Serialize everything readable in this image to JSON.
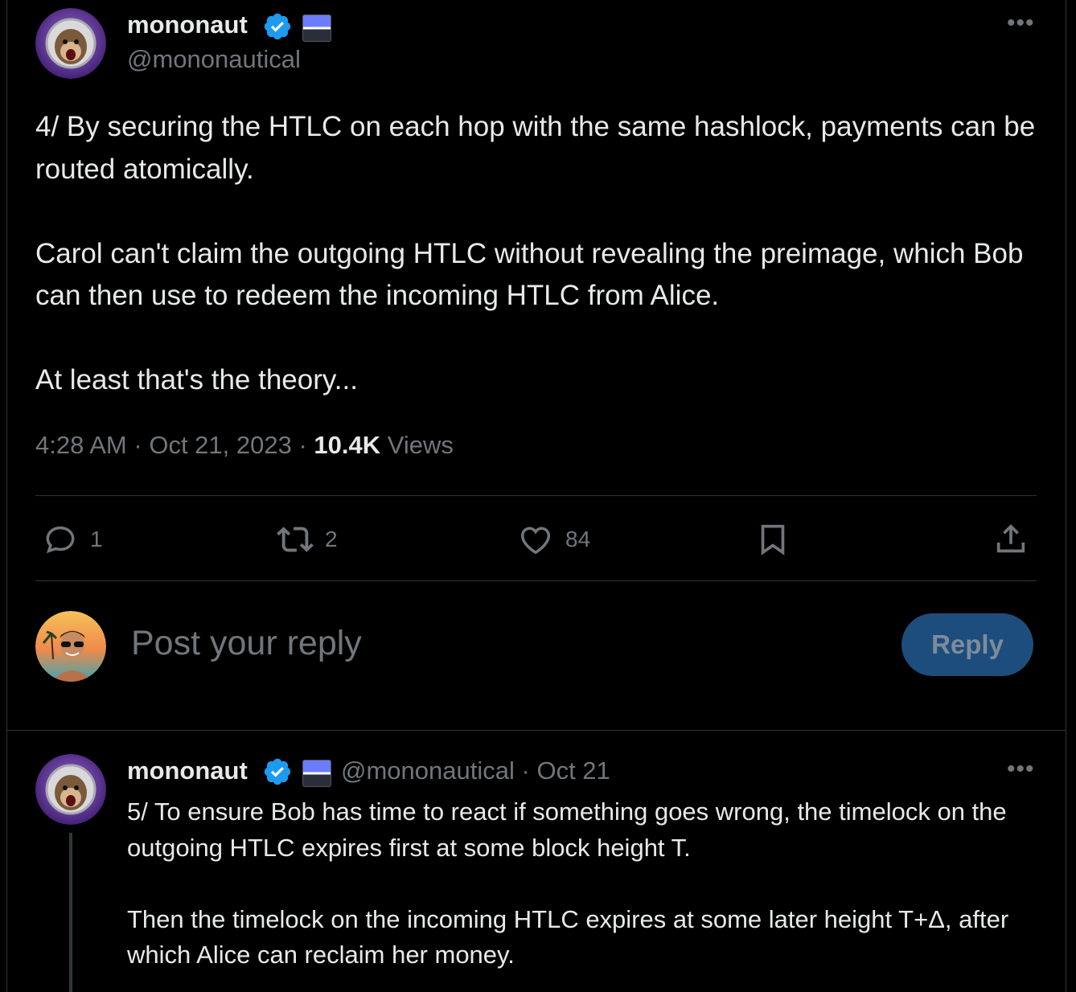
{
  "main_post": {
    "author_name": "mononaut",
    "author_handle": "@mononautical",
    "paragraphs": [
      "4/ By securing the HTLC on each hop with the same hashlock, payments can be routed atomically.",
      "Carol can't claim the outgoing HTLC without revealing the preimage, which Bob can then use to redeem the incoming HTLC from Alice.",
      "At least that's the theory..."
    ],
    "time": "4:28 AM",
    "date": "Oct 21, 2023",
    "views_count": "10.4K",
    "views_label": "Views",
    "separator": "·",
    "actions": {
      "replies": "1",
      "reposts": "2",
      "likes": "84"
    }
  },
  "reply_composer": {
    "placeholder": "Post your reply",
    "button_label": "Reply"
  },
  "thread_reply": {
    "author_name": "mononaut",
    "author_handle": "@mononautical",
    "separator": "·",
    "date": "Oct 21",
    "paragraphs": [
      "5/ To ensure Bob has time to react if something goes wrong, the timelock on the outgoing HTLC expires first at some block height T.",
      "Then the timelock on the incoming HTLC expires at some later height T+Δ, after which Alice can reclaim her money."
    ]
  },
  "colors": {
    "background": "#000000",
    "text_primary": "#e7e9ea",
    "text_secondary": "#71767b",
    "verified_blue": "#1d9bf0",
    "reply_button_bg": "#1d4d7c",
    "divider": "#2f3336"
  },
  "icons": [
    "verified-badge-icon",
    "ellipsis-icon",
    "reply-icon",
    "repost-icon",
    "like-icon",
    "bookmark-icon",
    "share-icon"
  ]
}
